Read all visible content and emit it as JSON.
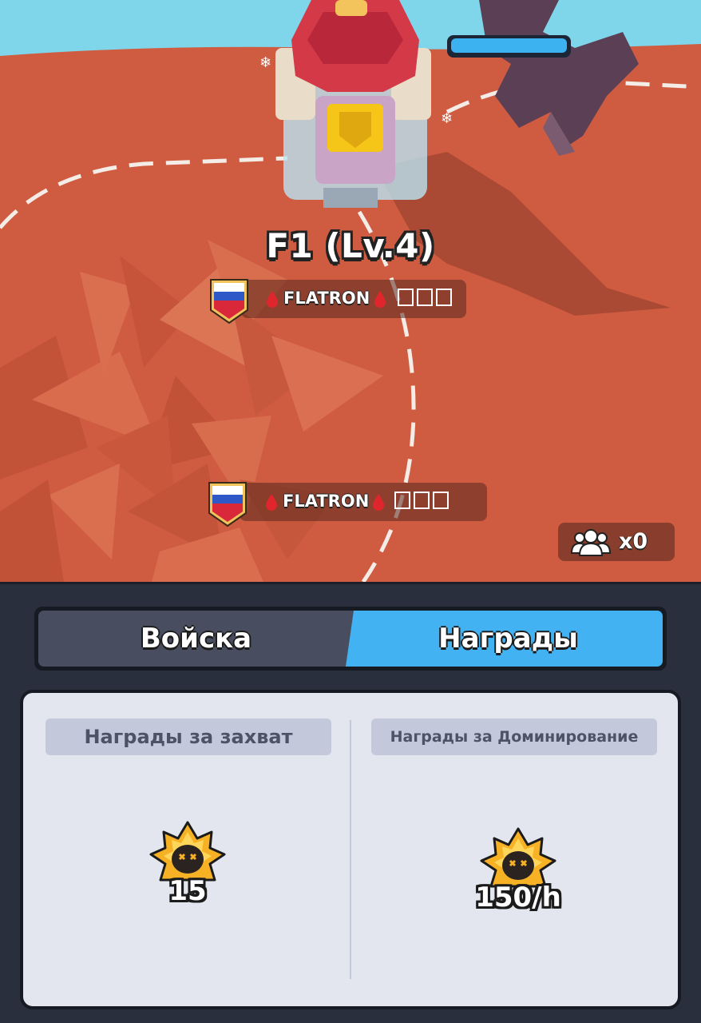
{
  "scene": {
    "building_title": "F1 (Lv.4)",
    "player_tags": [
      {
        "flag": "russia-flag",
        "name": "FLATRON"
      },
      {
        "flag": "russia-flag",
        "name": "FLATRON"
      }
    ],
    "troop_icon": "people-icon",
    "troop_count": "x0"
  },
  "tabs": [
    {
      "label": "Войска",
      "active": false
    },
    {
      "label": "Награды",
      "active": true
    }
  ],
  "rewards": {
    "capture": {
      "title": "Награды за захват",
      "icon": "skull-crown-icon",
      "value": "15"
    },
    "domination": {
      "title": "Награды за Доминирование",
      "icon": "skull-crown-icon",
      "value": "150/h"
    }
  },
  "colors": {
    "ground": "#cf5c41",
    "active_tab": "#42b2f2",
    "inactive_tab": "#484e60",
    "panel_bg": "#2a2f3d",
    "card_bg": "#e3e6ee"
  }
}
